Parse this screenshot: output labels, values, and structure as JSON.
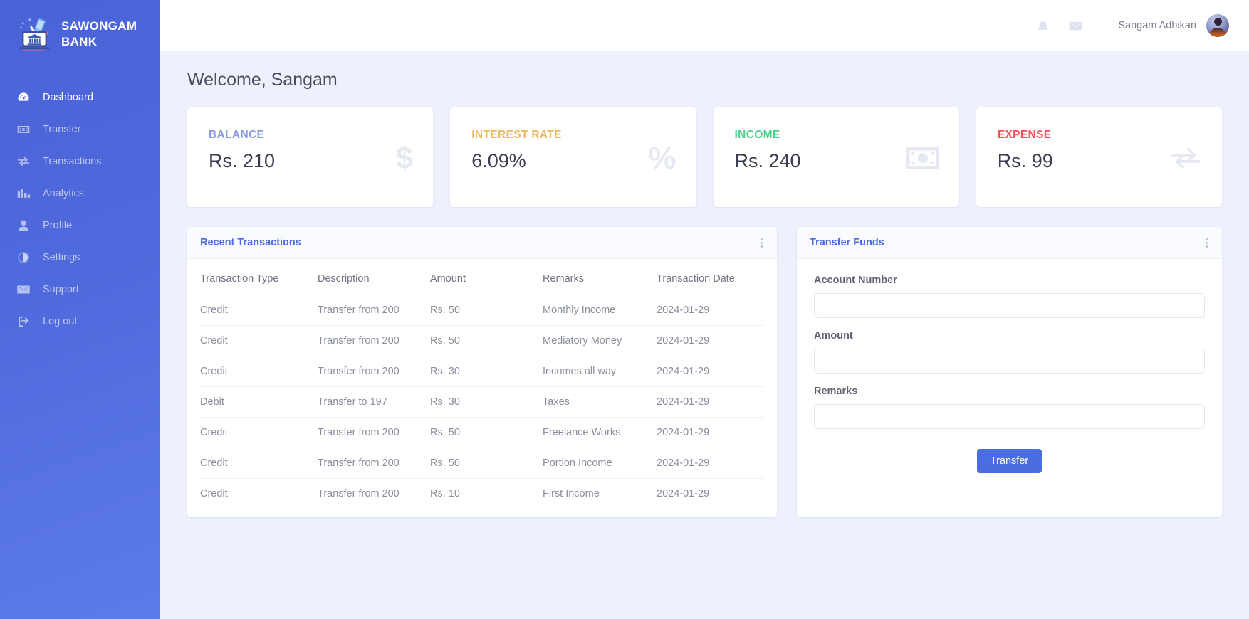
{
  "brand": {
    "name": "SAWONGAM BANK",
    "logo_icon": "bank-laptop-logo"
  },
  "sidebar": {
    "items": [
      {
        "label": "Dashboard",
        "icon": "dashboard-gauge-icon",
        "active": true
      },
      {
        "label": "Transfer",
        "icon": "money-bill-icon",
        "active": false
      },
      {
        "label": "Transactions",
        "icon": "exchange-arrows-icon",
        "active": false
      },
      {
        "label": "Analytics",
        "icon": "bar-chart-icon",
        "active": false
      },
      {
        "label": "Profile",
        "icon": "user-icon",
        "active": false
      },
      {
        "label": "Settings",
        "icon": "contrast-circle-icon",
        "active": false
      },
      {
        "label": "Support",
        "icon": "envelope-icon",
        "active": false
      },
      {
        "label": "Log out",
        "icon": "logout-icon",
        "active": false
      }
    ]
  },
  "topbar": {
    "notification_icon": "bell-icon",
    "message_icon": "envelope-icon",
    "user_name": "Sangam Adhikari",
    "avatar_icon": "user-avatar"
  },
  "page": {
    "welcome": "Welcome, Sangam"
  },
  "cards": [
    {
      "title": "BALANCE",
      "value": "Rs. 210",
      "color": "#8b9ae8",
      "icon": "dollar-sign-icon"
    },
    {
      "title": "INTEREST RATE",
      "value": "6.09%",
      "color": "#edb95e",
      "icon": "percent-icon"
    },
    {
      "title": "INCOME",
      "value": "Rs. 240",
      "color": "#4bcf8b",
      "icon": "money-bill-icon"
    },
    {
      "title": "EXPENSE",
      "value": "Rs. 99",
      "color": "#f4505a",
      "icon": "exchange-arrows-icon"
    }
  ],
  "transactions": {
    "panel_title": "Recent Transactions",
    "menu_icon": "kebab-menu-icon",
    "columns": [
      "Transaction Type",
      "Description",
      "Amount",
      "Remarks",
      "Transaction Date"
    ],
    "rows": [
      [
        "Credit",
        "Transfer from 200",
        "Rs. 50",
        "Monthly Income",
        "2024-01-29"
      ],
      [
        "Credit",
        "Transfer from 200",
        "Rs. 50",
        "Mediatory Money",
        "2024-01-29"
      ],
      [
        "Credit",
        "Transfer from 200",
        "Rs. 30",
        "Incomes all way",
        "2024-01-29"
      ],
      [
        "Debit",
        "Transfer to 197",
        "Rs. 30",
        "Taxes",
        "2024-01-29"
      ],
      [
        "Credit",
        "Transfer from 200",
        "Rs. 50",
        "Freelance Works",
        "2024-01-29"
      ],
      [
        "Credit",
        "Transfer from 200",
        "Rs. 50",
        "Portion Income",
        "2024-01-29"
      ],
      [
        "Credit",
        "Transfer from 200",
        "Rs. 10",
        "First Income",
        "2024-01-29"
      ]
    ]
  },
  "transfer": {
    "panel_title": "Transfer Funds",
    "menu_icon": "kebab-menu-icon",
    "fields": [
      {
        "label": "Account Number",
        "value": "",
        "placeholder": ""
      },
      {
        "label": "Amount",
        "value": "",
        "placeholder": ""
      },
      {
        "label": "Remarks",
        "value": "",
        "placeholder": ""
      }
    ],
    "submit_label": "Transfer",
    "submit_color": "#4a6ee0"
  }
}
